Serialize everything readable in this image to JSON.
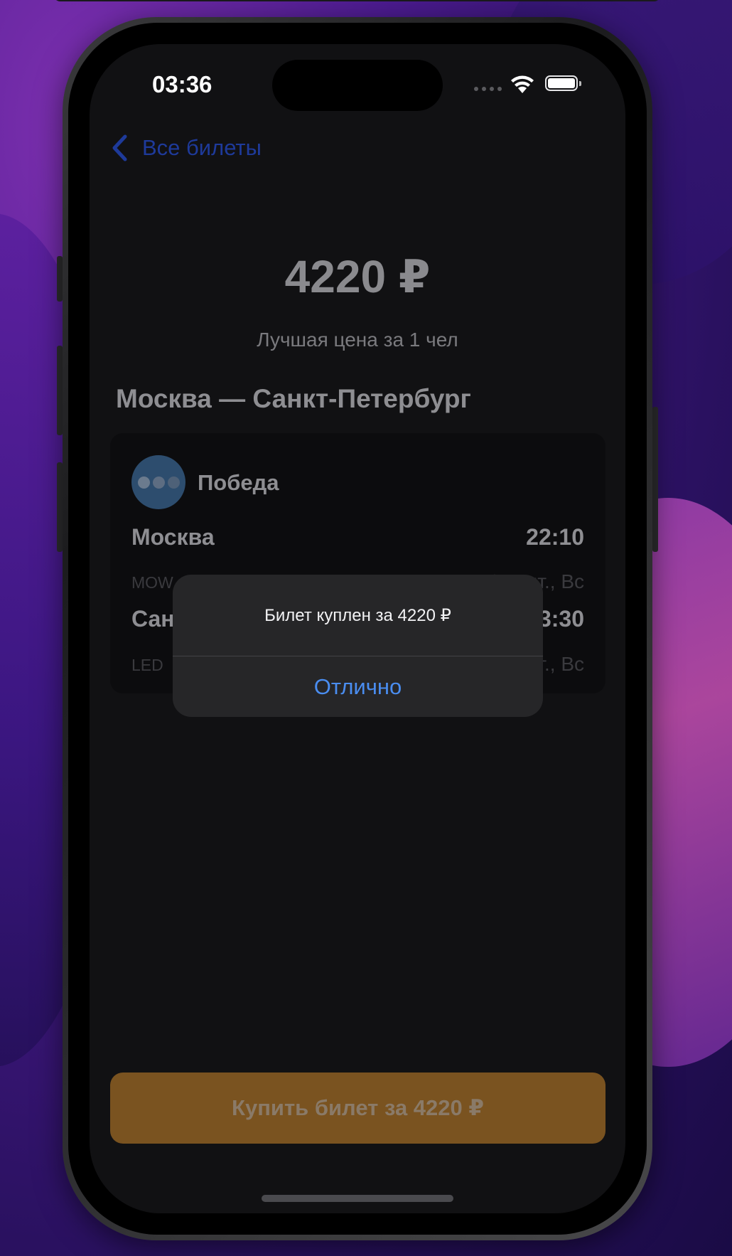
{
  "status_bar": {
    "time": "03:36",
    "icons": [
      "cellular-signal-icon",
      "wifi-icon",
      "battery-icon"
    ]
  },
  "nav": {
    "back_label": "Все билеты",
    "back_icon": "chevron-left-icon"
  },
  "summary": {
    "price": "4220 ₽",
    "price_caption": "Лучшая цена за 1 чел",
    "route_title": "Москва — Санкт-Петербург"
  },
  "ticket": {
    "airline": "Победа",
    "departure": {
      "city": "Москва",
      "time": "22:10",
      "code": "MOW",
      "date": "2 сент., Вс"
    },
    "arrival": {
      "city": "Санкт-Петербург",
      "time": "23:30",
      "code": "LED",
      "date": "2 сент., Вс"
    }
  },
  "buy_button": {
    "label": "Купить билет за 4220 ₽"
  },
  "alert": {
    "message": "Билет куплен за 4220 ₽",
    "button_label": "Отлично"
  },
  "colors": {
    "accent_blue": "#4a8df0",
    "buy_button": "#7a5320",
    "background": "#111113"
  }
}
